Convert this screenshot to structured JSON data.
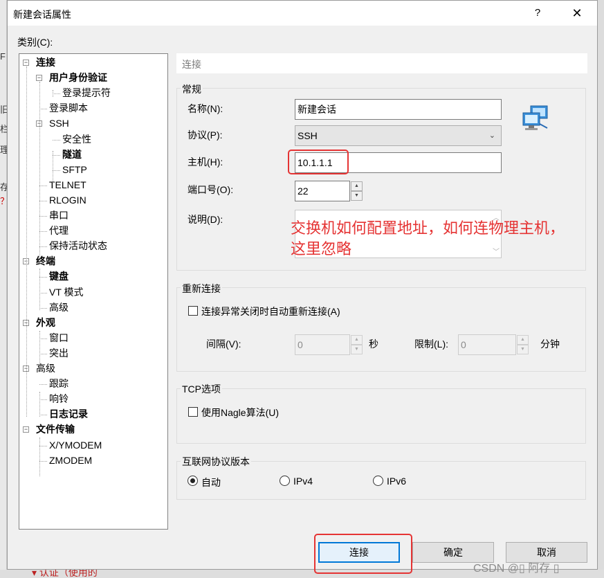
{
  "window": {
    "title": "新建会话属性",
    "help": "?",
    "close": "✕"
  },
  "category_label": "类别(C):",
  "tree": [
    {
      "label": "连接",
      "bold": true,
      "level": 0,
      "toggle": "−"
    },
    {
      "label": "用户身份验证",
      "bold": true,
      "level": 1,
      "toggle": "−"
    },
    {
      "label": "登录提示符",
      "bold": false,
      "level": 2
    },
    {
      "label": "登录脚本",
      "bold": false,
      "level": 1
    },
    {
      "label": "SSH",
      "bold": false,
      "level": 1,
      "toggle": "−"
    },
    {
      "label": "安全性",
      "bold": false,
      "level": 2
    },
    {
      "label": "隧道",
      "bold": true,
      "level": 2
    },
    {
      "label": "SFTP",
      "bold": false,
      "level": 2
    },
    {
      "label": "TELNET",
      "bold": false,
      "level": 1
    },
    {
      "label": "RLOGIN",
      "bold": false,
      "level": 1
    },
    {
      "label": "串口",
      "bold": false,
      "level": 1
    },
    {
      "label": "代理",
      "bold": false,
      "level": 1
    },
    {
      "label": "保持活动状态",
      "bold": false,
      "level": 1
    },
    {
      "label": "终端",
      "bold": true,
      "level": 0,
      "toggle": "−"
    },
    {
      "label": "键盘",
      "bold": true,
      "level": 1
    },
    {
      "label": "VT 模式",
      "bold": false,
      "level": 1
    },
    {
      "label": "高级",
      "bold": false,
      "level": 1
    },
    {
      "label": "外观",
      "bold": true,
      "level": 0,
      "toggle": "−"
    },
    {
      "label": "窗口",
      "bold": false,
      "level": 1
    },
    {
      "label": "突出",
      "bold": false,
      "level": 1
    },
    {
      "label": "高级",
      "bold": false,
      "level": 0,
      "toggle": "−"
    },
    {
      "label": "跟踪",
      "bold": false,
      "level": 1
    },
    {
      "label": "响铃",
      "bold": false,
      "level": 1
    },
    {
      "label": "日志记录",
      "bold": true,
      "level": 1
    },
    {
      "label": "文件传输",
      "bold": true,
      "level": 0,
      "toggle": "−"
    },
    {
      "label": "X/YMODEM",
      "bold": false,
      "level": 1
    },
    {
      "label": "ZMODEM",
      "bold": false,
      "level": 1
    }
  ],
  "panel_header": "连接",
  "general": {
    "title": "常规",
    "name_label": "名称(N):",
    "name_value": "新建会话",
    "protocol_label": "协议(P):",
    "protocol_value": "SSH",
    "host_label": "主机(H):",
    "host_value": "10.1.1.1",
    "port_label": "端口号(O):",
    "port_value": "22",
    "desc_label": "说明(D):"
  },
  "annotation": {
    "line1": "交换机如何配置地址，如何连物理主机，",
    "line2": "这里忽略"
  },
  "reconnect": {
    "title": "重新连接",
    "checkbox_label": "连接异常关闭时自动重新连接(A)",
    "interval_label": "间隔(V):",
    "interval_value": "0",
    "interval_unit": "秒",
    "limit_label": "限制(L):",
    "limit_value": "0",
    "limit_unit": "分钟"
  },
  "tcp": {
    "title": "TCP选项",
    "nagle_label": "使用Nagle算法(U)"
  },
  "ip_version": {
    "title": "互联网协议版本",
    "auto": "自动",
    "ipv4": "IPv4",
    "ipv6": "IPv6"
  },
  "buttons": {
    "connect": "连接",
    "ok": "确定",
    "cancel": "取消"
  },
  "watermark": "CSDN @▯    阿存  ▯",
  "background": {
    "bottom_text": "▾ 认证（使用的",
    "left_chars": [
      "F",
      "旧",
      "栏",
      "理",
      "存",
      "？"
    ]
  }
}
